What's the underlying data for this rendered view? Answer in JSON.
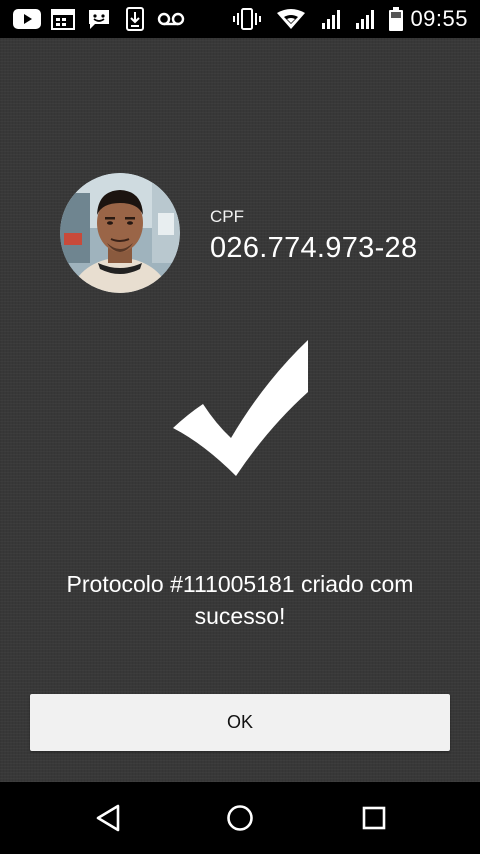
{
  "status_bar": {
    "time": "09:55",
    "icons": [
      "youtube-icon",
      "calendar-icon",
      "messaging-icon",
      "download-icon",
      "voicemail-icon",
      "vibrate-icon",
      "wifi-icon",
      "signal-icon",
      "signal-icon",
      "battery-icon"
    ]
  },
  "profile": {
    "avatar": "avatar-photo",
    "cpf_label": "CPF",
    "cpf_value": "026.774.973-28"
  },
  "confirmation": {
    "icon": "checkmark-icon",
    "message": "Protocolo #111005181 criado com sucesso!"
  },
  "ok_button": {
    "label": "OK"
  },
  "nav_bar": {
    "icons": [
      "back-icon",
      "home-icon",
      "recents-icon"
    ]
  },
  "colors": {
    "background": "#383838",
    "button": "#f1f1f1",
    "bars": "#000000"
  }
}
